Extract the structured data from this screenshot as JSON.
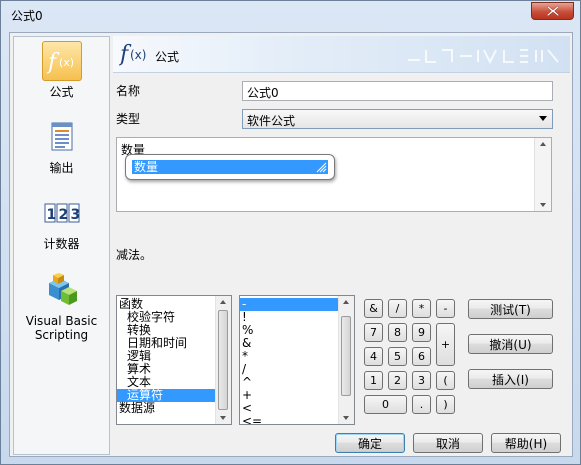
{
  "window": {
    "title": "公式0"
  },
  "nav": {
    "items": [
      {
        "label": "公式",
        "icon": "formula-icon"
      },
      {
        "label": "输出",
        "icon": "output-icon"
      },
      {
        "label": "计数器",
        "icon": "counter-icon"
      },
      {
        "label": "Visual Basic Scripting",
        "label_line1": "Visual Basic",
        "label_line2": "Scripting",
        "icon": "vb-scripting-icon"
      }
    ]
  },
  "header": {
    "title": "公式",
    "icon": "fx-icon",
    "icon_text": "f(x)"
  },
  "form": {
    "name_label": "名称",
    "name_value": "公式0",
    "type_label": "类型",
    "type_value": "软件公式",
    "formula_text": "数量",
    "autocomplete_selected": "数量",
    "description": "减法。"
  },
  "categories": {
    "items": [
      "函数",
      "校验字符",
      "转换",
      "日期和时间",
      "逻辑",
      "算术",
      "文本",
      "运算符",
      "数据源"
    ],
    "selected_index": 7
  },
  "operators": {
    "items": [
      "-",
      "!",
      "%",
      "&",
      "*",
      "/",
      "^",
      "+",
      "<",
      "<="
    ],
    "selected_index": 0
  },
  "keypad": {
    "row1": [
      "&",
      "/",
      "*",
      "-"
    ],
    "row2": [
      "7",
      "8",
      "9"
    ],
    "row3": [
      "4",
      "5",
      "6"
    ],
    "row4": [
      "1",
      "2",
      "3",
      "("
    ],
    "row5": [
      "0",
      ".",
      ")"
    ],
    "plus": "+"
  },
  "actions": {
    "test": "测试(T)",
    "undo": "撤消(U)",
    "insert": "插入(I)"
  },
  "footer": {
    "ok": "确定",
    "cancel": "取消",
    "help": "帮助(H)"
  },
  "colors": {
    "selection": "#3399ff",
    "nav_selected": "#f6c04f",
    "title_gradient": "#c8d9ee"
  }
}
